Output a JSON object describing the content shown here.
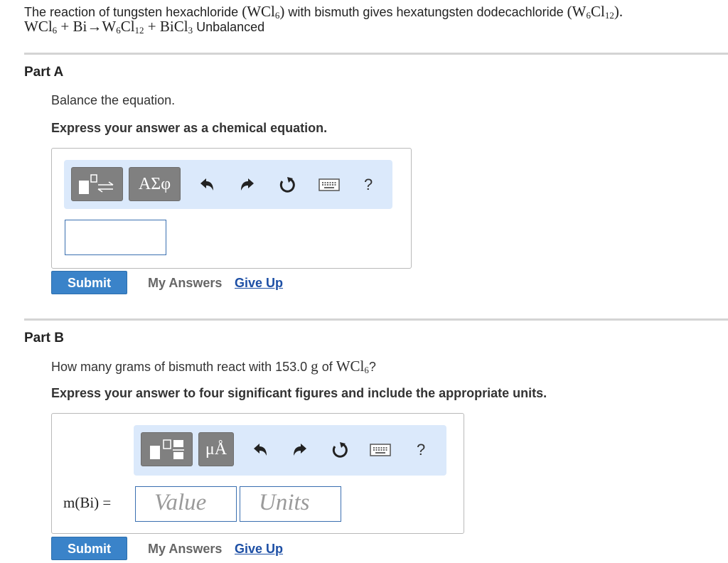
{
  "intro": {
    "sentence_start": "The reaction of tungsten hexachloride",
    "reactant_formula": "(WCl",
    "reactant_sub": "6",
    "reactant_close": ")",
    "sentence_mid": "with bismuth gives hexatungsten dodecachloride",
    "product_formula_a": "(W",
    "product_sub_a": "6",
    "product_formula_b": "Cl",
    "product_sub_b": "12",
    "product_close": ").",
    "eq_wcl": "WCl",
    "eq_wcl_sub": "6",
    "eq_plus1": " + Bi→W",
    "eq_w_sub": "6",
    "eq_cl": "Cl",
    "eq_cl_sub": "12",
    "eq_plus2": " + BiCl",
    "eq_bicl_sub": "3",
    "eq_note": "Unbalanced"
  },
  "partA": {
    "title": "Part A",
    "prompt": "Balance the equation.",
    "instruction": "Express your answer as a chemical equation.",
    "toolbar": {
      "greek_label": "ΑΣφ",
      "help_label": "?",
      "icons": [
        "templates-icon",
        "greek-letters-icon",
        "undo-icon",
        "redo-icon",
        "reset-icon",
        "keyboard-icon",
        "help-icon"
      ]
    },
    "submit_label": "Submit",
    "my_answers_label": "My Answers",
    "give_up_label": "Give Up"
  },
  "partB": {
    "title": "Part B",
    "prompt_start": "How many grams of bismuth react with 153.0",
    "prompt_unit": "g",
    "prompt_of": "of",
    "prompt_formula": "WCl",
    "prompt_formula_sub": "6",
    "prompt_end": "?",
    "instruction": "Express your answer to four significant figures and include the appropriate units.",
    "toolbar": {
      "units_label": "μÅ",
      "help_label": "?",
      "icons": [
        "templates-icon",
        "units-icon",
        "undo-icon",
        "redo-icon",
        "reset-icon",
        "keyboard-icon",
        "help-icon"
      ]
    },
    "variable_label": "m(Bi) =",
    "value_placeholder": "Value",
    "units_placeholder": "Units",
    "submit_label": "Submit",
    "my_answers_label": "My Answers",
    "give_up_label": "Give Up"
  },
  "colors": {
    "submit_bg": "#3a83c9",
    "toolbar_bg": "#dbe9fb",
    "toolbar_button": "#808080",
    "link": "#1d4fa5",
    "divider": "#d4d4d4"
  }
}
